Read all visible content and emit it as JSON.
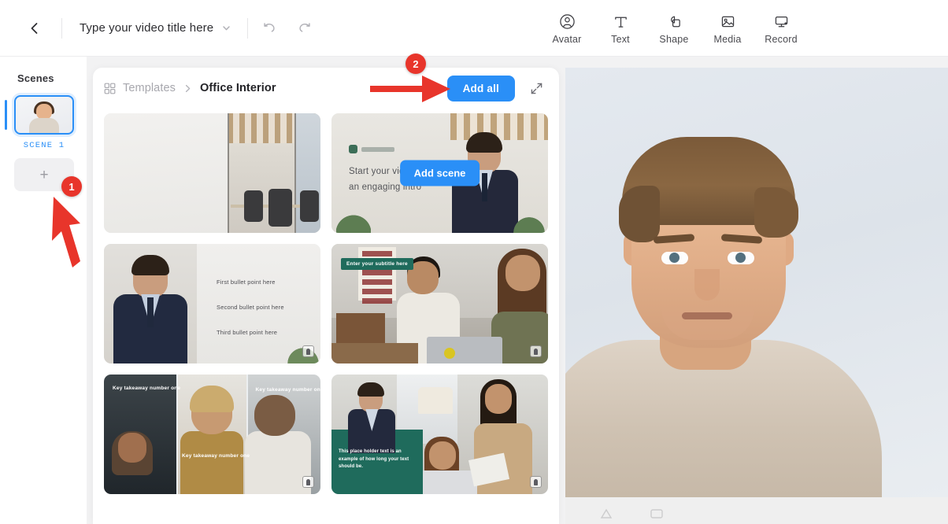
{
  "topbar": {
    "back_icon": "chevron-left-icon",
    "title_value": "Type your video title here",
    "title_dropdown_icon": "chevron-down-icon",
    "undo_icon": "undo-icon",
    "redo_icon": "redo-icon",
    "tools": [
      {
        "label": "Avatar",
        "icon": "avatar-icon"
      },
      {
        "label": "Text",
        "icon": "text-icon"
      },
      {
        "label": "Shape",
        "icon": "shape-icon"
      },
      {
        "label": "Media",
        "icon": "media-icon"
      },
      {
        "label": "Record",
        "icon": "record-icon"
      }
    ]
  },
  "sidebar": {
    "title": "Scenes",
    "scenes": [
      {
        "label": "SCENE 1",
        "selected": true
      }
    ],
    "add_scene_icon": "plus-icon"
  },
  "templates": {
    "breadcrumb": {
      "grid_icon": "grid-icon",
      "root": "Templates",
      "separator_icon": "chevron-right-icon",
      "current": "Office Interior"
    },
    "add_all_label": "Add all",
    "expand_icon": "expand-icon",
    "hover_add_label": "Add scene",
    "cards": [
      {
        "name": "office-interior-blank",
        "texts": []
      },
      {
        "name": "presenter-intro-slide",
        "texts": [
          "Start your video with",
          "an engaging intro"
        ],
        "hovered": true
      },
      {
        "name": "presenter-bullets",
        "texts": [
          "First bullet point here",
          "Second bullet point here",
          "Third bullet point here"
        ]
      },
      {
        "name": "team-subtitle",
        "texts": [
          "Enter your subtitle here"
        ]
      },
      {
        "name": "triptych-key-takeaways",
        "texts": [
          "Key takeaway\nnumber one",
          "Key takeaway\nnumber one",
          "Key takeaway\nnumber one"
        ]
      },
      {
        "name": "presenter-placeholder-text",
        "texts": [
          "This place holder text is an example of how long your text should be."
        ]
      }
    ]
  },
  "annotations": [
    {
      "number": "1",
      "target": "add-scene-button"
    },
    {
      "number": "2",
      "target": "add-all-button"
    }
  ],
  "colors": {
    "accent_blue": "#2a8ff7",
    "annotation_red": "#e8352b",
    "teal": "#1f6b5c"
  }
}
